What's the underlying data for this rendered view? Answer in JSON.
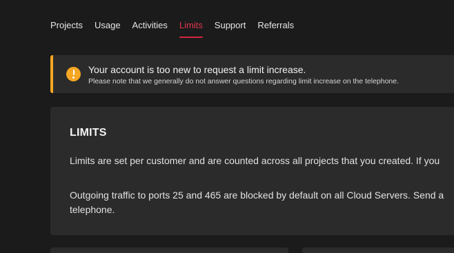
{
  "tabs": [
    {
      "label": "Projects",
      "active": false
    },
    {
      "label": "Usage",
      "active": false
    },
    {
      "label": "Activities",
      "active": false
    },
    {
      "label": "Limits",
      "active": true
    },
    {
      "label": "Support",
      "active": false
    },
    {
      "label": "Referrals",
      "active": false
    }
  ],
  "alert": {
    "icon": "exclamation-icon",
    "color": "#f5a623",
    "title": "Your account is too new to request a limit increase.",
    "subtitle": "Please note that we generally do not answer questions regarding limit increase on the telephone."
  },
  "limits_card": {
    "title": "LIMITS",
    "paragraph1": "Limits are set per customer and are counted across all projects that you created. If you",
    "paragraph2_line1": "Outgoing traffic to ports 25 and 465 are blocked by default on all Cloud Servers. Send a",
    "paragraph2_line2": "telephone."
  },
  "colors": {
    "background": "#1b1b1b",
    "card": "#2b2b2b",
    "accent": "#d5263f",
    "warning": "#f5a623"
  }
}
